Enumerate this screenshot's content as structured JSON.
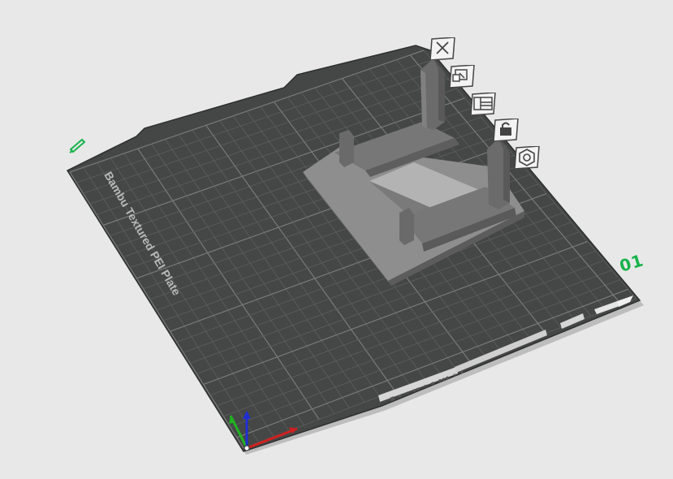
{
  "plate": {
    "label": "Bambu Textured PEI Plate",
    "number": "01",
    "qr_strip_text": "■ ▪ ▫ ▪▪ ▫ ▪ ▪▪▪ ▫ ▪"
  },
  "toolbar": {
    "buttons": [
      {
        "name": "delete-plate-button",
        "icon": "close-icon"
      },
      {
        "name": "arrange-plate-button",
        "icon": "arrange-icon"
      },
      {
        "name": "orient-plate-button",
        "icon": "layout-icon"
      },
      {
        "name": "lock-plate-button",
        "icon": "lock-icon"
      },
      {
        "name": "plate-settings-button",
        "icon": "hexagon-gear-icon"
      }
    ]
  },
  "edit": {
    "icon": "pencil-icon"
  },
  "colors": {
    "background": "#e8e8e8",
    "plate": "#454746",
    "grid_minor": "#5d5f5e",
    "grid_major": "#797b7a",
    "model_top": "#9a9a9a",
    "model_side": "#6e6e6e",
    "model_dark": "#565656",
    "accent_green": "#17b34a",
    "axis_x": "#d21f1f",
    "axis_y": "#1fb31f",
    "axis_z": "#1f2fd2"
  }
}
